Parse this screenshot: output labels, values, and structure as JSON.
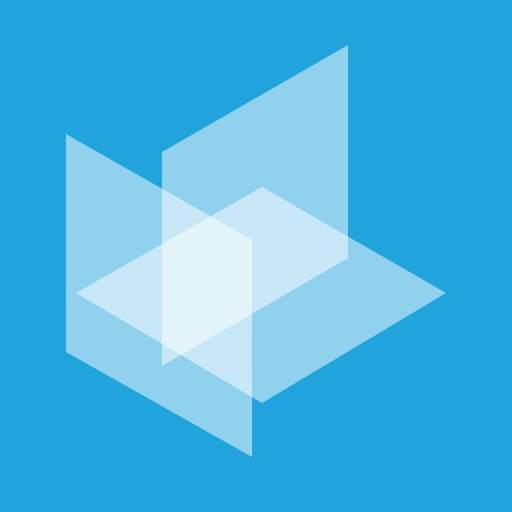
{
  "colors": {
    "background": "#21a3dd",
    "plane": "#ffffff"
  },
  "icon": {
    "name": "translucent-planes-logo-icon",
    "plane_count": 3
  }
}
